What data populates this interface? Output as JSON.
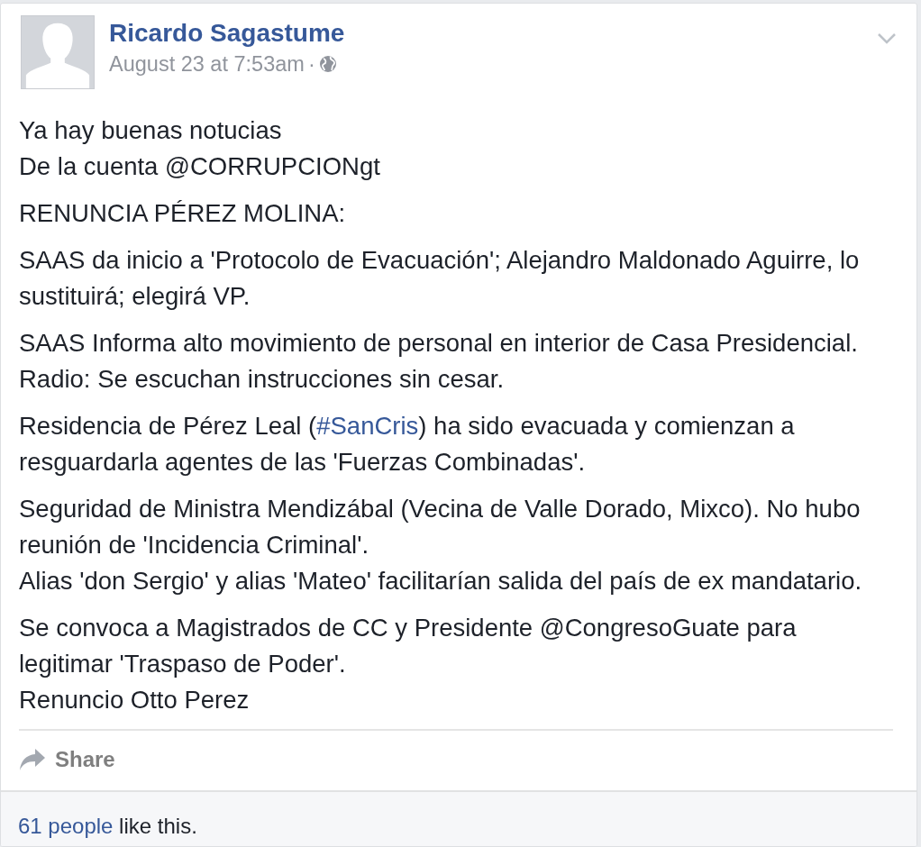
{
  "post": {
    "author": "Ricardo Sagastume",
    "timestamp": "August 23 at 7:53am",
    "separator": "·",
    "public": true,
    "paragraphs": [
      [
        [
          {
            "text": "Ya hay buenas notucias"
          }
        ],
        [
          {
            "text": "De la cuenta @CORRUPCIONgt"
          }
        ]
      ],
      [
        [
          {
            "text": "RENUNCIA PÉREZ MOLINA:"
          }
        ]
      ],
      [
        [
          {
            "text": "SAAS da inicio a 'Protocolo de Evacuación'; Alejandro Maldonado Aguirre, lo"
          }
        ],
        [
          {
            "text": "sustituirá; elegirá VP."
          }
        ]
      ],
      [
        [
          {
            "text": "SAAS Informa alto movimiento de personal en interior de Casa Presidencial."
          }
        ],
        [
          {
            "text": "Radio: Se escuchan instrucciones sin cesar."
          }
        ]
      ],
      [
        [
          {
            "text": "Residencia de Pérez Leal ("
          },
          {
            "text": "#SanCris",
            "kind": "link"
          },
          {
            "text": ") ha sido evacuada y comienzan a"
          }
        ],
        [
          {
            "text": "resguardarla agentes de las 'Fuerzas Combinadas'."
          }
        ]
      ],
      [
        [
          {
            "text": "Seguridad de Ministra Mendizábal (Vecina de Valle Dorado, Mixco). No hubo"
          }
        ],
        [
          {
            "text": "reunión de 'Incidencia Criminal'."
          }
        ],
        [
          {
            "text": "Alias 'don Sergio' y alias 'Mateo' facilitarían salida del país de ex mandatario."
          }
        ]
      ],
      [
        [
          {
            "text": "Se convoca a Magistrados de CC y Presidente @CongresoGuate para"
          }
        ],
        [
          {
            "text": "legitimar 'Traspaso de Poder'."
          }
        ],
        [
          {
            "text": "Renuncio Otto Perez"
          }
        ]
      ]
    ],
    "actions": [
      {
        "label": "Share"
      }
    ],
    "likes": {
      "count": "61 people",
      "text": " like this."
    }
  }
}
